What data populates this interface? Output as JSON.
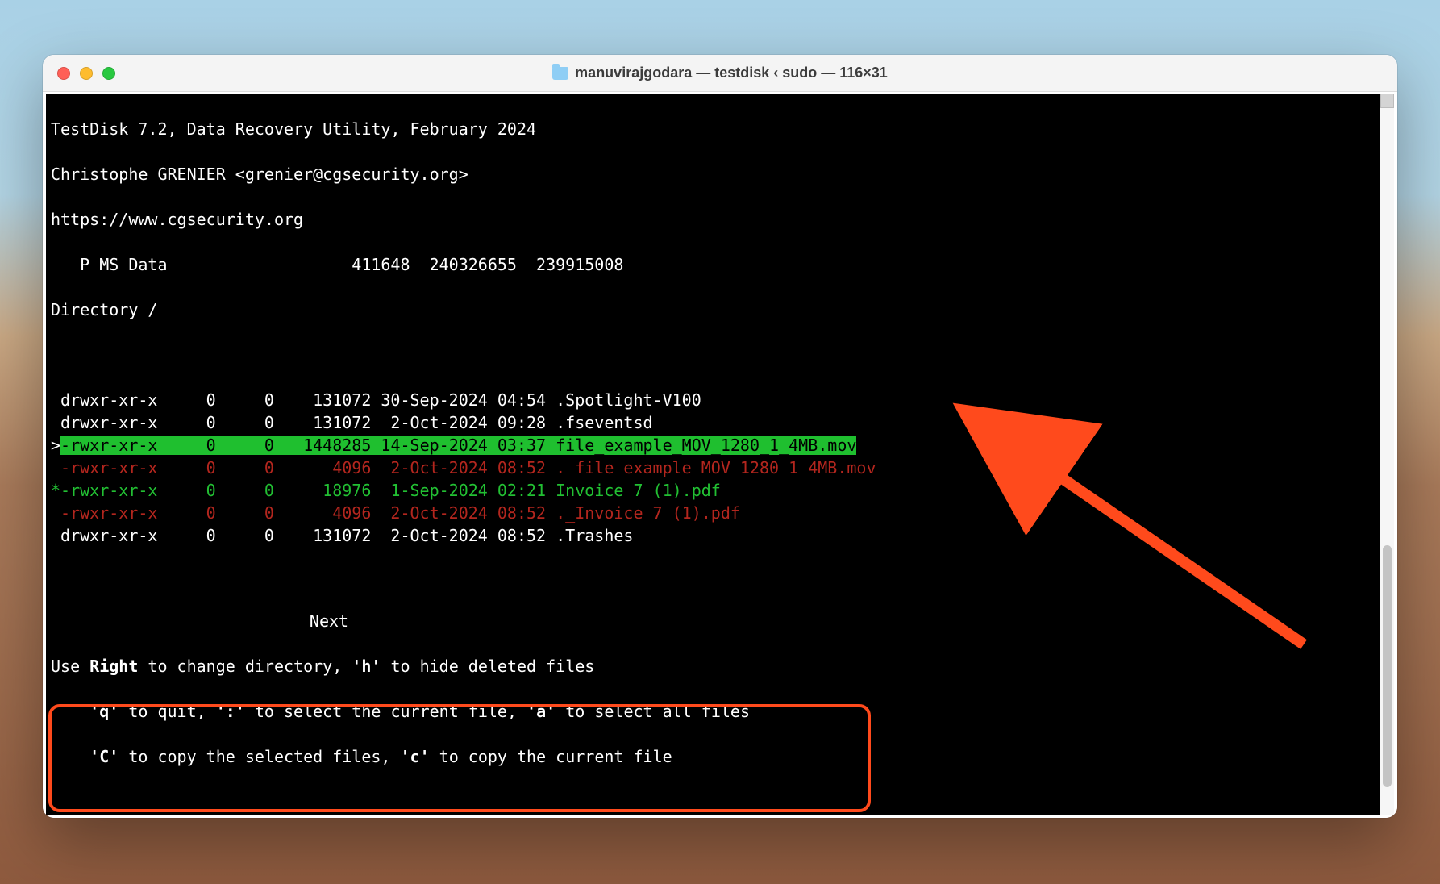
{
  "window": {
    "title": "manuvirajgodara — testdisk ‹ sudo — 116×31"
  },
  "header": {
    "line1": "TestDisk 7.2, Data Recovery Utility, February 2024",
    "line2": "Christophe GRENIER <grenier@cgsecurity.org>",
    "line3": "https://www.cgsecurity.org",
    "partition": "   P MS Data                   411648  240326655  239915008",
    "dir": "Directory /"
  },
  "rows": [
    {
      "prefix": " ",
      "perm": "drwxr-xr-x",
      "uid": "0",
      "gid": "0",
      "size": "131072",
      "date": "30-Sep-2024",
      "time": "04:54",
      "name": ".Spotlight-V100",
      "style": "plain"
    },
    {
      "prefix": " ",
      "perm": "drwxr-xr-x",
      "uid": "0",
      "gid": "0",
      "size": "131072",
      "date": " 2-Oct-2024",
      "time": "09:28",
      "name": ".fseventsd",
      "style": "plain"
    },
    {
      "prefix": ">",
      "perm": "-rwxr-xr-x",
      "uid": "0",
      "gid": "0",
      "size": "1448285",
      "date": "14-Sep-2024",
      "time": "03:37",
      "name": "file_example_MOV_1280_1_4MB.mov",
      "style": "hl"
    },
    {
      "prefix": " ",
      "perm": "-rwxr-xr-x",
      "uid": "0",
      "gid": "0",
      "size": "4096",
      "date": " 2-Oct-2024",
      "time": "08:52",
      "name": "._file_example_MOV_1280_1_4MB.mov",
      "style": "red"
    },
    {
      "prefix": "*",
      "perm": "-rwxr-xr-x",
      "uid": "0",
      "gid": "0",
      "size": "18976",
      "date": " 1-Sep-2024",
      "time": "02:21",
      "name": "Invoice 7 (1).pdf",
      "style": "green"
    },
    {
      "prefix": " ",
      "perm": "-rwxr-xr-x",
      "uid": "0",
      "gid": "0",
      "size": "4096",
      "date": " 2-Oct-2024",
      "time": "08:52",
      "name": "._Invoice 7 (1).pdf",
      "style": "red"
    },
    {
      "prefix": " ",
      "perm": "drwxr-xr-x",
      "uid": "0",
      "gid": "0",
      "size": "131072",
      "date": " 2-Oct-2024",
      "time": "08:52",
      "name": ".Trashes",
      "style": "plain"
    }
  ],
  "footer": {
    "next": "Next",
    "l1_a": "Use ",
    "l1_b": "Right",
    "l1_c": " to change directory, ",
    "l1_d": "'h'",
    "l1_e": " to hide deleted files",
    "l2_a": "    ",
    "l2_b": "'q'",
    "l2_c": " to quit, ",
    "l2_d": "':'",
    "l2_e": " to select the current file, ",
    "l2_f": "'a'",
    "l2_g": " to select all files",
    "l3_a": "    ",
    "l3_b": "'C'",
    "l3_c": " to copy the selected files, ",
    "l3_d": "'c'",
    "l3_e": " to copy the current file"
  },
  "colors": {
    "arrow": "#ff4a1c",
    "box": "#ff4a1c"
  }
}
